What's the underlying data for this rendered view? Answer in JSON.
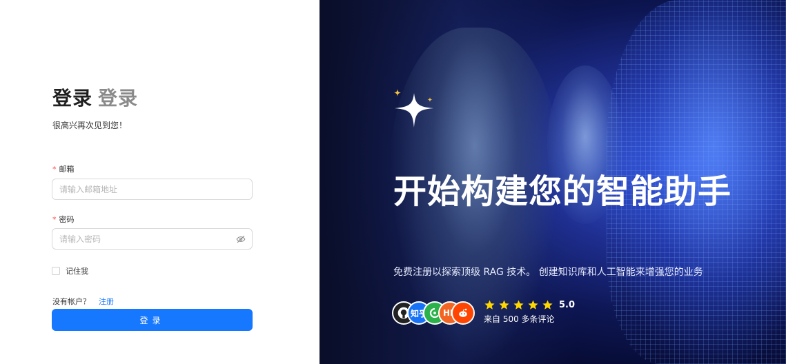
{
  "login": {
    "title_main": "登录",
    "title_secondary": "登录",
    "subtitle": "很高兴再次见到您！",
    "email": {
      "required_mark": "*",
      "label": "邮箱",
      "placeholder": "请输入邮箱地址",
      "value": ""
    },
    "password": {
      "required_mark": "*",
      "label": "密码",
      "placeholder": "请输入密码",
      "value": ""
    },
    "remember_label": "记住我",
    "no_account_text": "没有帐户？",
    "signup_link": "注册",
    "submit_label": "登录"
  },
  "hero": {
    "title": "开始构建您的智能助手",
    "description": "免费注册以探索顶级 RAG 技术。 创建知识库和人工智能来增强您的业务",
    "avatars": [
      {
        "icon": "github-icon",
        "text": ""
      },
      {
        "icon": "zhihu-icon",
        "text": "知乎"
      },
      {
        "icon": "wechat-icon",
        "text": ""
      },
      {
        "icon": "hacker-news-icon",
        "text": "HN"
      },
      {
        "icon": "reddit-icon",
        "text": ""
      }
    ],
    "rating_score": "5.0",
    "stars": 5,
    "review_text": "来自 500 多条评论"
  },
  "colors": {
    "primary": "#1677ff",
    "required": "#ff4d4f",
    "star": "#ffd700",
    "hero_bg": "#0d1652"
  }
}
